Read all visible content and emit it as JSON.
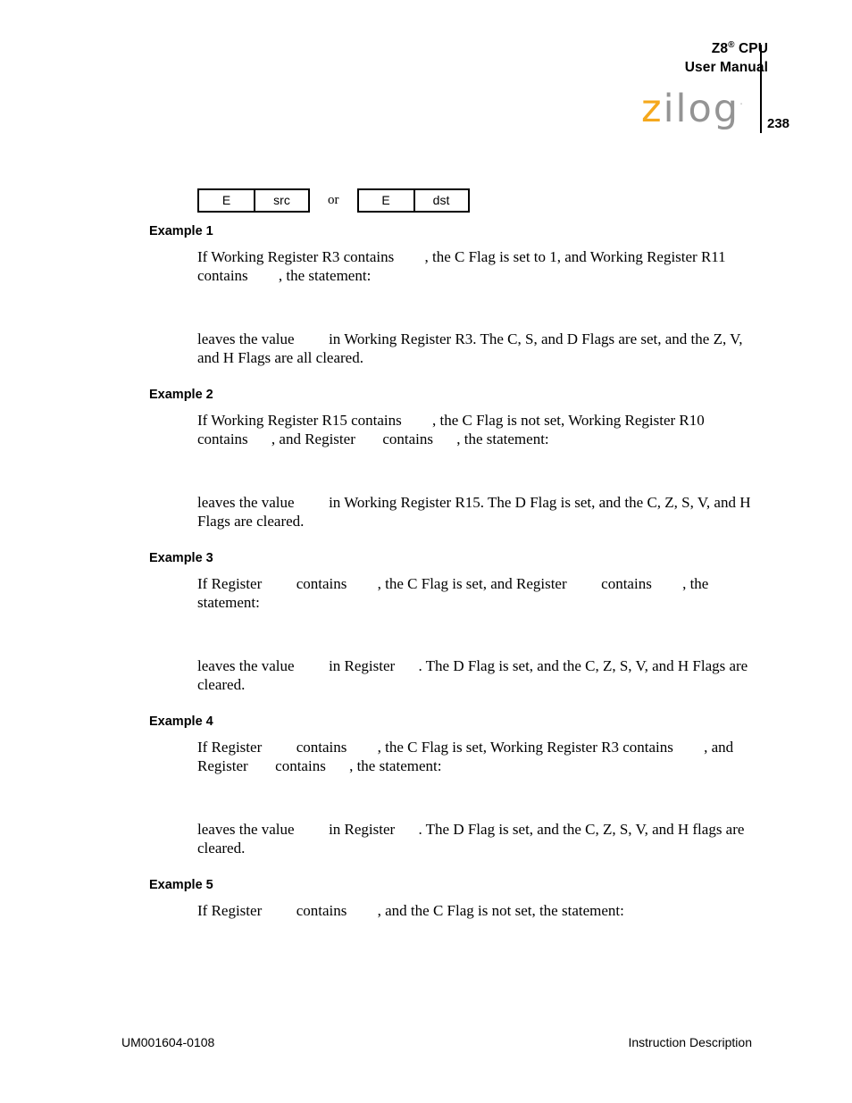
{
  "header": {
    "title_line1_main": "Z8",
    "title_line1_sup": "®",
    "title_line1_tail": " CPU",
    "title_line2": "User Manual",
    "page_number": "238",
    "logo_z": "z",
    "logo_rest": "ilog",
    "logo_dot": "·"
  },
  "diagram": {
    "box1_cell1": "E",
    "box1_cell2": "src",
    "separator": "or",
    "box2_cell1": "E",
    "box2_cell2": "dst"
  },
  "examples": [
    {
      "heading": "Example 1",
      "condition_parts": [
        "If Working Register R3 contains ",
        ", the C Flag is set to 1, and Working Register R11 contains ",
        ", the statement:"
      ],
      "result_parts": [
        "leaves the value ",
        " in Working Register R3. The C, S, and D Flags are set, and the Z, V, and H Flags are all cleared."
      ]
    },
    {
      "heading": "Example 2",
      "condition_parts": [
        "If Working Register R15 contains ",
        ", the C Flag is not set, Working Register R10 contains ",
        ", and Register ",
        " contains ",
        ", the statement:"
      ],
      "result_parts": [
        "leaves the value ",
        " in Working Register R15. The D Flag is set, and the C, Z, S, V, and H Flags are cleared."
      ]
    },
    {
      "heading": "Example 3",
      "condition_parts": [
        "If Register ",
        " contains ",
        ", the C Flag is set, and Register ",
        " contains ",
        ", the statement:"
      ],
      "result_parts": [
        "leaves the value ",
        " in Register ",
        ". The D Flag is set, and the C, Z, S, V, and H Flags are cleared."
      ]
    },
    {
      "heading": "Example 4",
      "condition_parts": [
        "If Register ",
        " contains ",
        ", the C Flag is set, Working Register R3 contains ",
        ", and Register ",
        " contains ",
        ", the statement:"
      ],
      "result_parts": [
        "leaves the value ",
        " in Register ",
        ". The D Flag is set, and the C, Z, S, V, and H flags are cleared."
      ]
    },
    {
      "heading": "Example 5",
      "condition_parts": [
        "If Register ",
        " contains ",
        ", and the C Flag is not set, the statement:"
      ],
      "result_parts": []
    }
  ],
  "footer": {
    "document_id": "UM001604-0108",
    "section": "Instruction Description"
  }
}
